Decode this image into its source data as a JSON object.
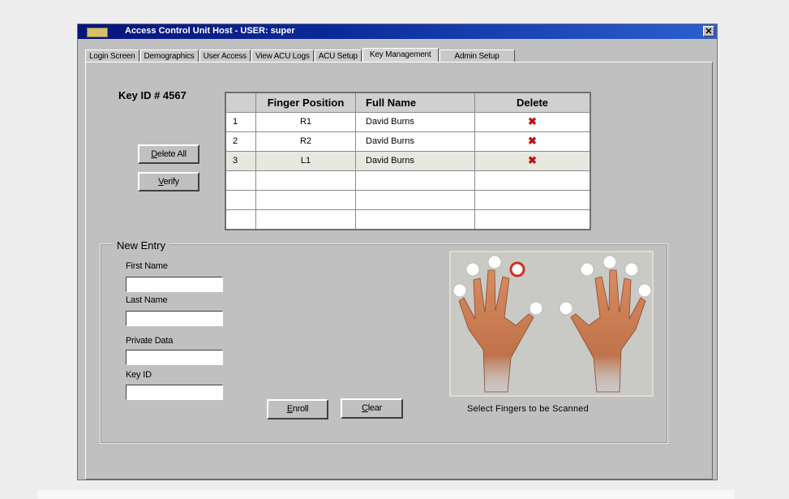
{
  "window": {
    "title": "Access Control Unit Host - USER: super",
    "close_glyph": "✕"
  },
  "tabs": [
    {
      "label": "Login Screen",
      "active": false
    },
    {
      "label": "Demographics",
      "active": false
    },
    {
      "label": "User Access",
      "active": false
    },
    {
      "label": "View ACU Logs",
      "active": false
    },
    {
      "label": "ACU Setup",
      "active": false
    },
    {
      "label": "Key Management",
      "active": true
    },
    {
      "label": "Admin Setup",
      "active": false
    }
  ],
  "key_id_label": "Key ID # 4567",
  "buttons": {
    "delete_all_ul": "D",
    "delete_all_rest": "elete All",
    "verify_ul": "V",
    "verify_rest": "erify",
    "enroll_ul": "E",
    "enroll_rest": "nroll",
    "clear_ul": "C",
    "clear_rest": "lear"
  },
  "table": {
    "headers": [
      "",
      "Finger Position",
      "Full Name",
      "Delete"
    ],
    "rows": [
      {
        "num": "1",
        "position": "R1",
        "name": "David Burns",
        "delete": "✖"
      },
      {
        "num": "2",
        "position": "R2",
        "name": "David Burns",
        "delete": "✖"
      },
      {
        "num": "3",
        "position": "L1",
        "name": "David Burns",
        "delete": "✖"
      }
    ]
  },
  "new_entry": {
    "title": "New Entry",
    "fields": [
      {
        "label": "First Name",
        "value": ""
      },
      {
        "label": "Last Name",
        "value": ""
      },
      {
        "label": "Private Data",
        "value": ""
      },
      {
        "label": "Key ID",
        "value": ""
      }
    ]
  },
  "hands": {
    "caption": "Select Fingers to be Scanned",
    "skin_color": "#c87a52",
    "selected_ring_color": "#d03020",
    "finger_buttons": [
      "L5",
      "L4",
      "L3",
      "L2",
      "L1",
      "R1",
      "R2",
      "R3",
      "R4",
      "R5"
    ],
    "selected": [
      "L2"
    ]
  },
  "colors": {
    "title_bar": "#0a2a9a",
    "window_bg": "#c0c0c0",
    "delete_icon": "#c01010"
  }
}
